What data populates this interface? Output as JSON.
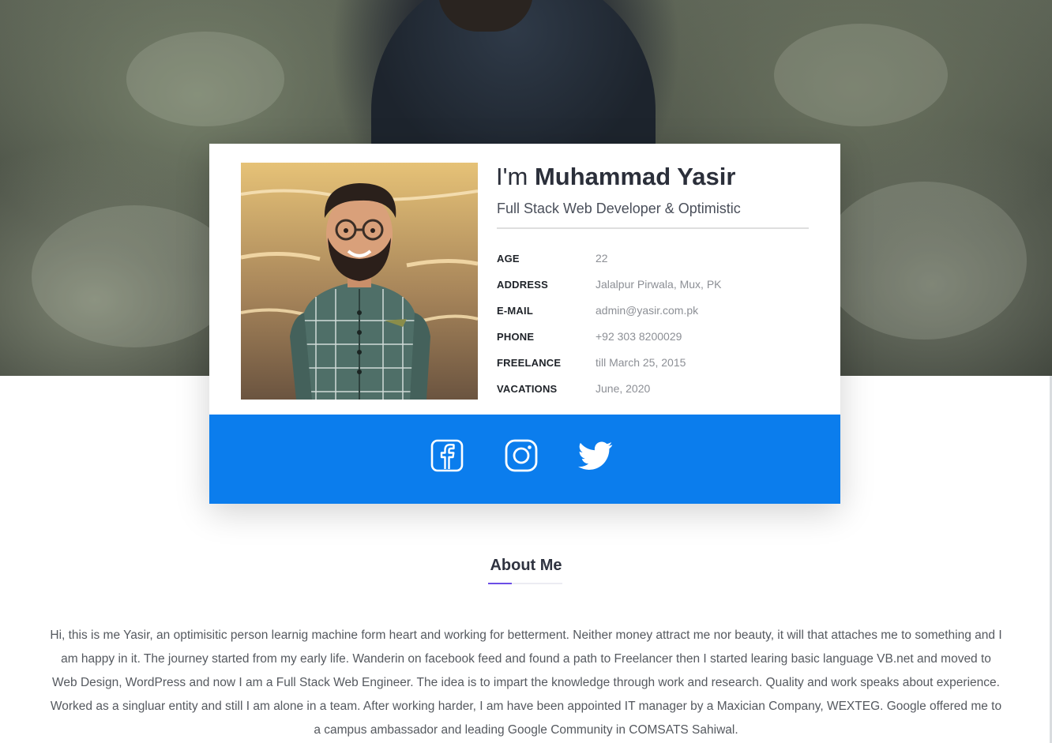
{
  "profile": {
    "greeting": "I'm",
    "name": "Muhammad Yasir",
    "title": "Full Stack Web Developer & Optimistic",
    "avatar_icon": "cartoon-avatar",
    "details": [
      {
        "label": "AGE",
        "value": "22"
      },
      {
        "label": "ADDRESS",
        "value": "Jalalpur Pirwala, Mux, PK"
      },
      {
        "label": "E-MAIL",
        "value": "admin@yasir.com.pk"
      },
      {
        "label": "PHONE",
        "value": "+92 303 8200029"
      },
      {
        "label": "FREELANCE",
        "value": "till March 25, 2015"
      },
      {
        "label": "VACATIONS",
        "value": "June, 2020"
      }
    ]
  },
  "social": {
    "bar_color": "#0b7ded",
    "icons": [
      "facebook-icon",
      "instagram-icon",
      "twitter-icon"
    ]
  },
  "about": {
    "title": "About Me",
    "accent_color": "#6b4de6",
    "text": "Hi, this is me Yasir, an optimisitic person learnig machine form heart and working for betterment. Neither money attract me nor beauty, it will that attaches me to something and I am happy in it. The journey started from my early life. Wanderin on facebook feed and found a path to Freelancer then I started learing basic language VB.net and moved to Web Design, WordPress and now I am a Full Stack Web Engineer. The idea is to impart the knowledge through work and research. Quality and work speaks about experience. Worked as a singluar entity and still I am alone in a team. After working harder, I am have been appointed IT manager by a Maxician Company, WEXTEG. Google offered me to a campus ambassador and leading Google Community in COMSATS Sahiwal."
  }
}
